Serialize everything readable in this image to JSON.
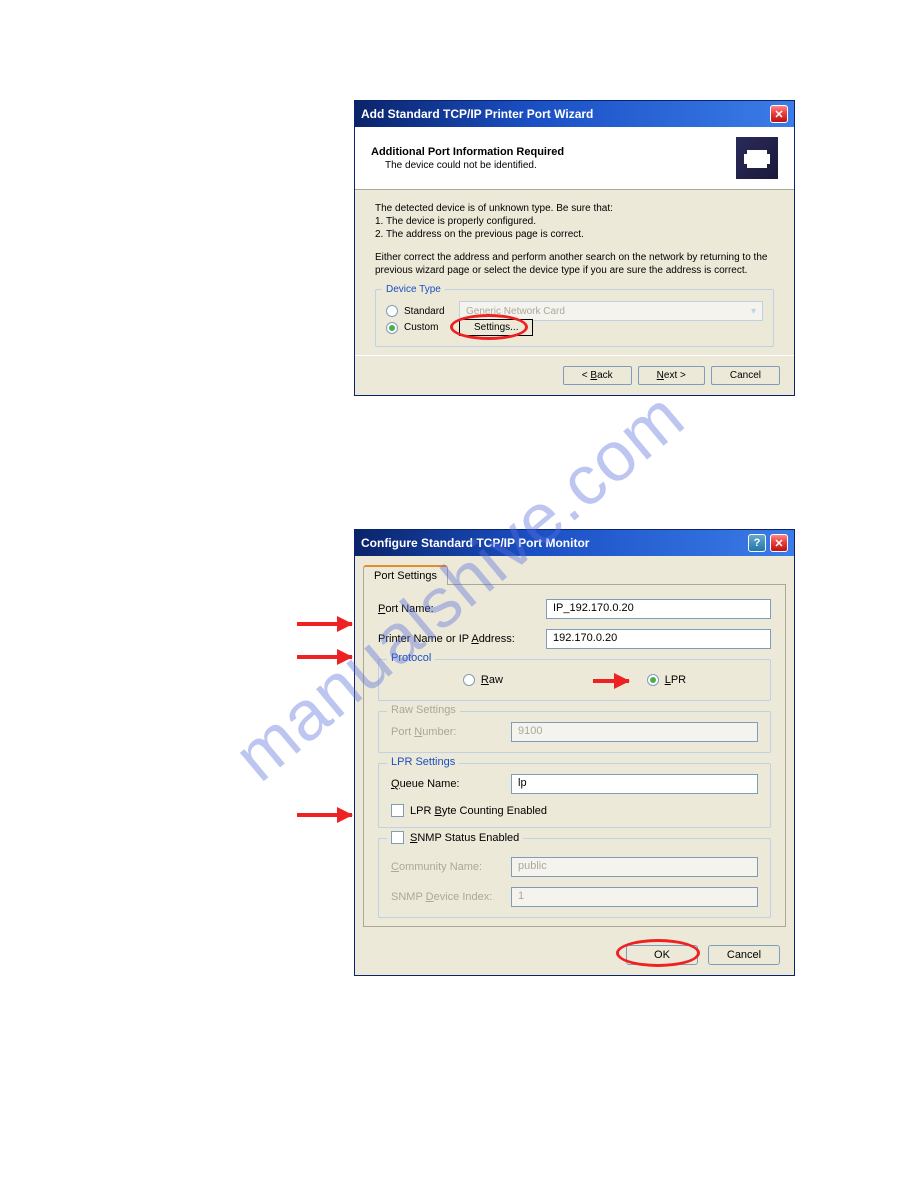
{
  "watermark": "manualshive.com",
  "dialog1": {
    "title": "Add Standard TCP/IP Printer Port Wizard",
    "header_title": "Additional Port Information Required",
    "header_sub": "The device could not be identified.",
    "body_line1": "The detected device is of unknown type.  Be sure that:",
    "body_line2": "1. The device is properly configured.",
    "body_line3": "2.  The address on the previous page is correct.",
    "body_para2": "Either correct the address and perform another search on the network by returning to the previous wizard page or select the device type if you are sure the address is correct.",
    "device_type_legend": "Device Type",
    "radio_standard": "Standard",
    "radio_custom": "Custom",
    "dropdown_value": "Generic Network Card",
    "settings_btn": "Settings...",
    "back_btn": "Back",
    "next_btn": "Next >",
    "cancel_btn": "Cancel"
  },
  "dialog2": {
    "title": "Configure Standard TCP/IP Port Monitor",
    "tab": "Port Settings",
    "port_name_label": "Port Name:",
    "port_name_value": "IP_192.170.0.20",
    "printer_name_label": "Printer Name or IP Address:",
    "printer_name_value": "192.170.0.20",
    "protocol_legend": "Protocol",
    "proto_raw": "Raw",
    "proto_lpr": "LPR",
    "raw_legend": "Raw Settings",
    "raw_port_label": "Port Number:",
    "raw_port_value": "9100",
    "lpr_legend": "LPR Settings",
    "queue_label": "Queue Name:",
    "queue_value": "lp",
    "lpr_checkbox": "LPR Byte Counting Enabled",
    "snmp_checkbox": "SNMP Status Enabled",
    "community_label": "Community Name:",
    "community_value": "public",
    "snmp_index_label": "SNMP Device Index:",
    "snmp_index_value": "1",
    "ok_btn": "OK",
    "cancel_btn": "Cancel"
  }
}
